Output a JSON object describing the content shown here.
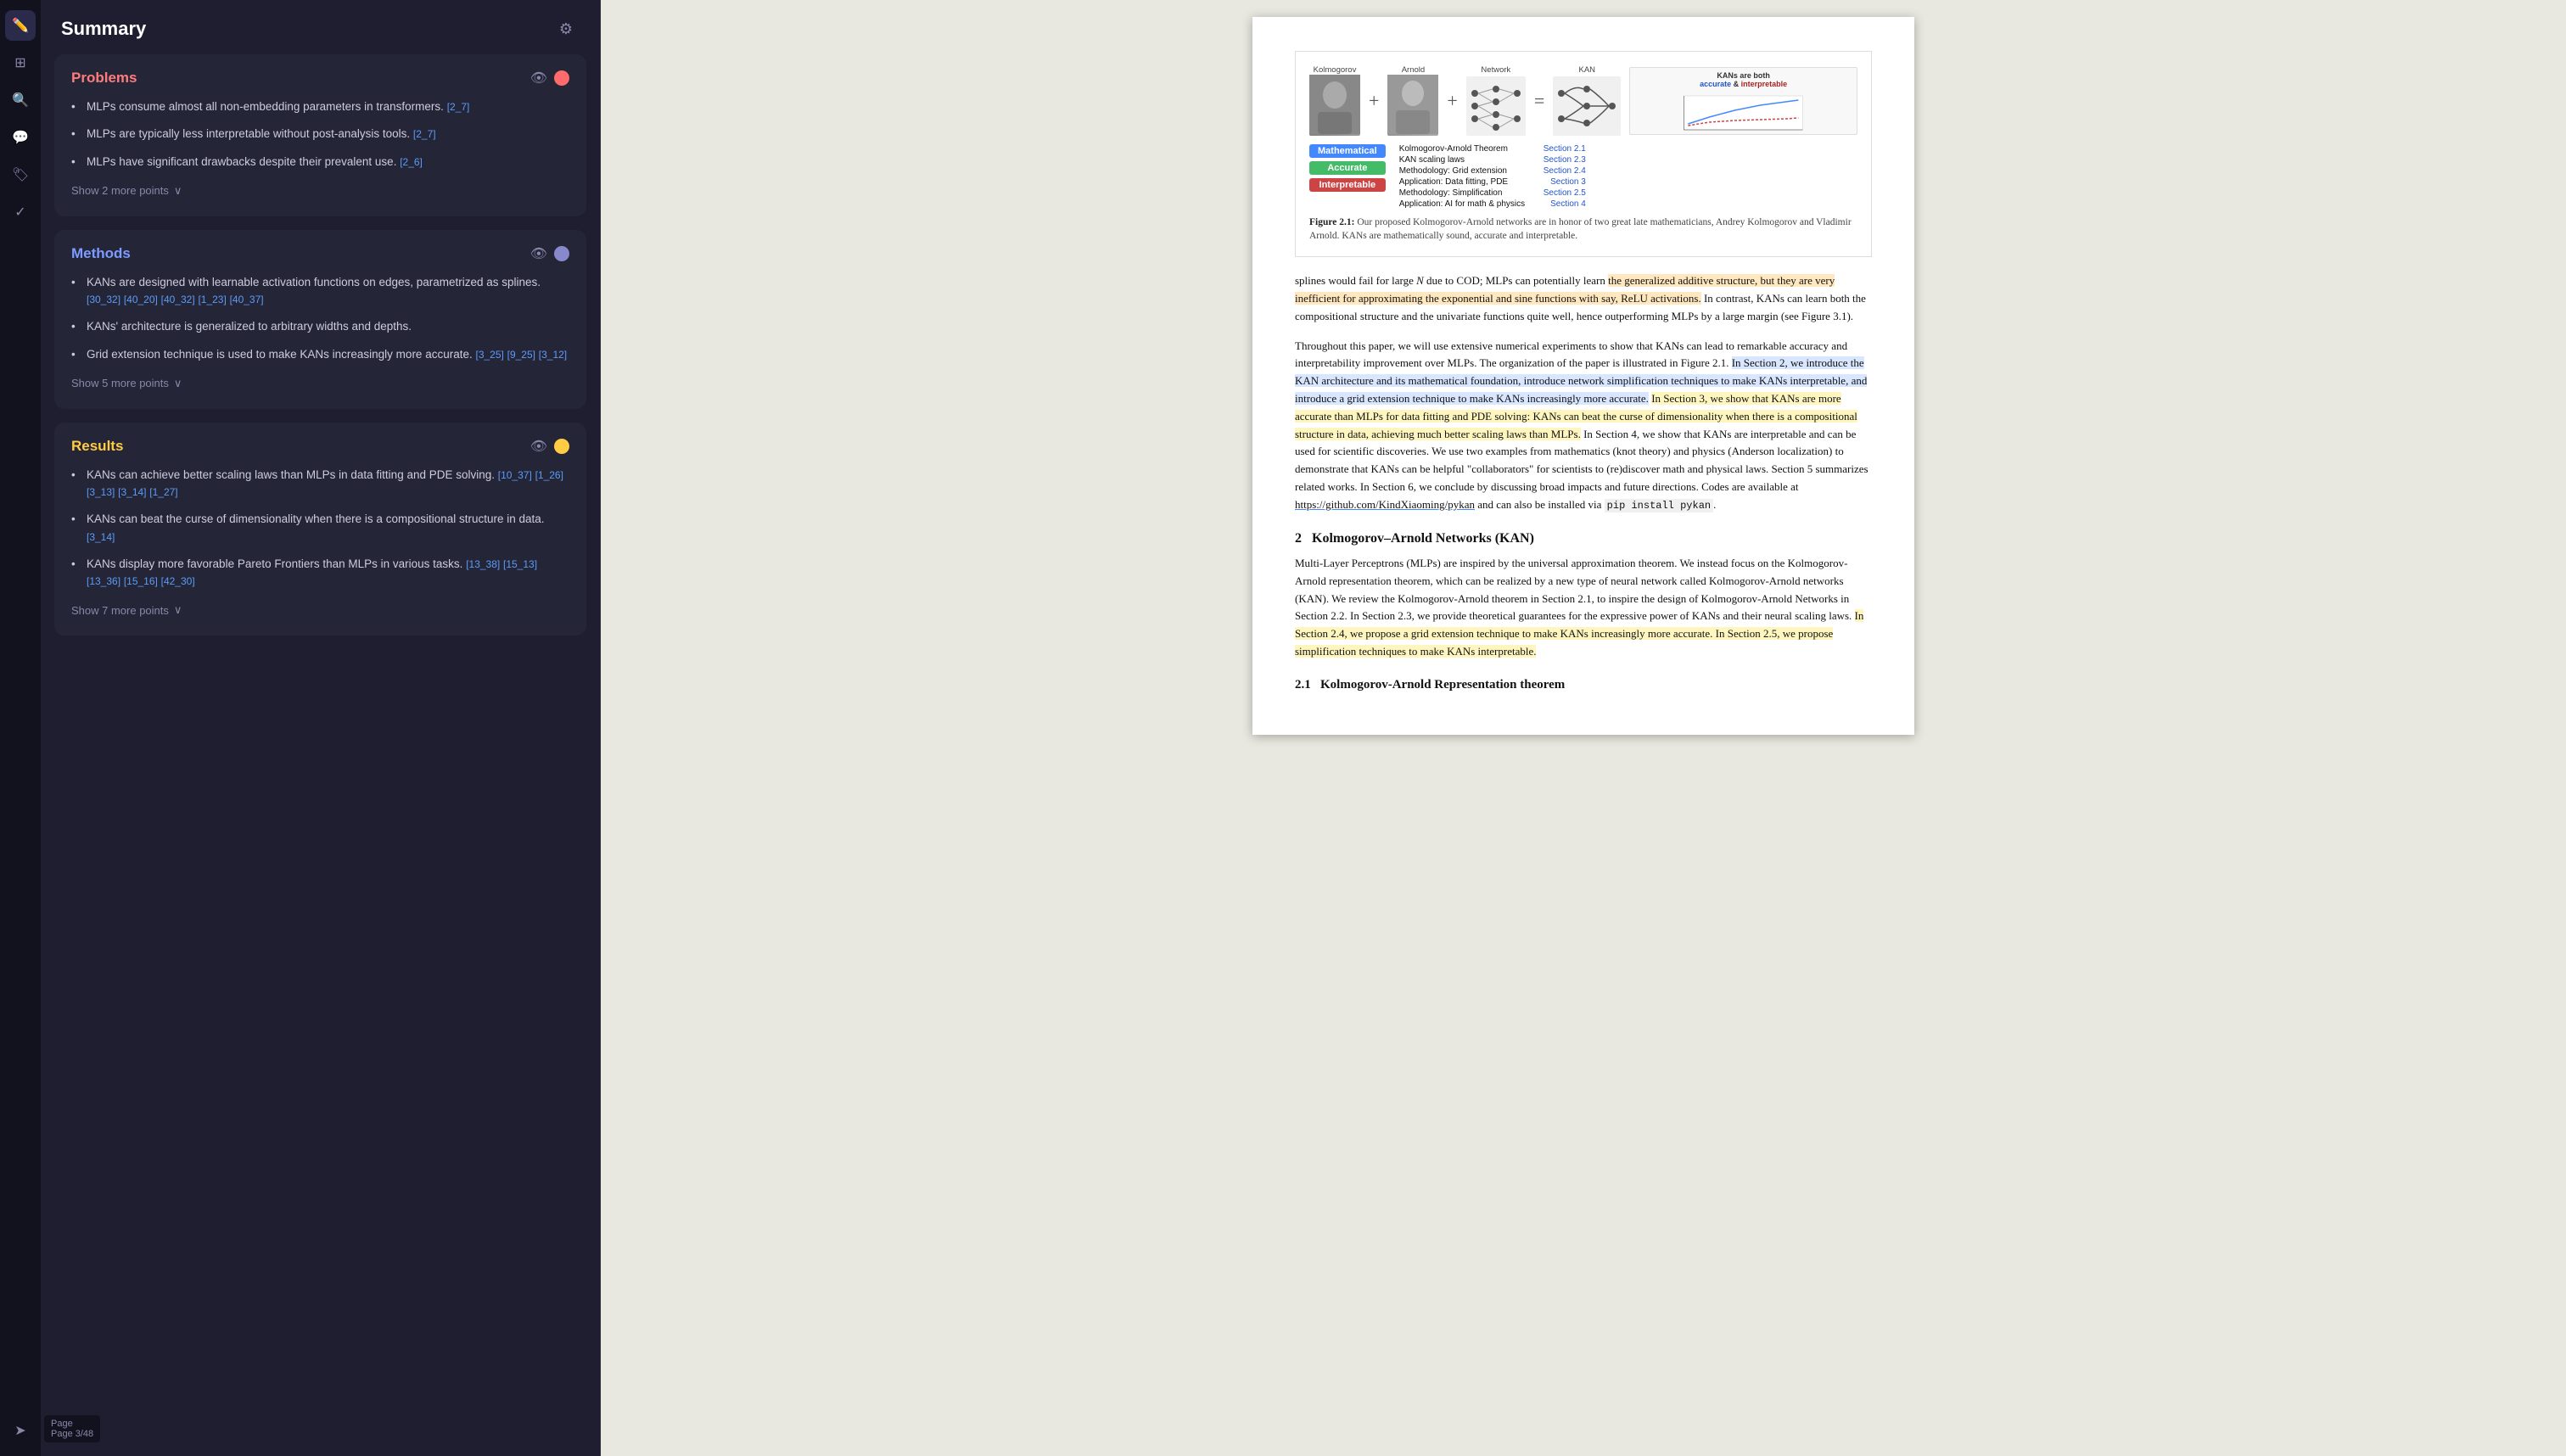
{
  "app": {
    "title": "Summary",
    "page_indicator": "Page\n3/48"
  },
  "sidebar": {
    "icons": [
      {
        "name": "pen-icon",
        "symbol": "✏️",
        "active": true
      },
      {
        "name": "layers-icon",
        "symbol": "⧉",
        "active": false
      },
      {
        "name": "search-icon",
        "symbol": "🔍",
        "active": false
      },
      {
        "name": "chat-icon",
        "symbol": "💬",
        "active": false
      },
      {
        "name": "bookmark-icon",
        "symbol": "🏷️",
        "active": false
      },
      {
        "name": "checkmark-icon",
        "symbol": "✓",
        "active": false
      },
      {
        "name": "send-icon",
        "symbol": "➤",
        "active": false
      }
    ]
  },
  "cards": [
    {
      "id": "problems",
      "title": "Problems",
      "title_class": "problems",
      "dot_color": "#ff6b6b",
      "bullets": [
        "MLPs consume almost all non-embedding parameters in transformers. [2_7]",
        "MLPs are typically less interpretable without post-analysis tools. [2_7]",
        "MLPs have significant drawbacks despite their prevalent use. [2_6]"
      ],
      "refs": [
        "[2_7]",
        "[2_7]",
        "[2_6]"
      ],
      "show_more_label": "Show 2 more points"
    },
    {
      "id": "methods",
      "title": "Methods",
      "title_class": "methods",
      "dot_color": "#8888cc",
      "bullets": [
        "KANs are designed with learnable activation functions on edges, parametrized as splines. [30_32] [40_20] [40_32] [1_23] [40_37]",
        "KANs' architecture is generalized to arbitrary widths and depths.",
        "Grid extension technique is used to make KANs increasingly more accurate. [3_25] [9_25] [3_12]"
      ],
      "refs_first": "[30_32] [40_20] [40_32] [1_23] [40_37]",
      "refs_third": "[3_25] [9_25] [3_12]",
      "show_more_label": "Show 5 more points"
    },
    {
      "id": "results",
      "title": "Results",
      "title_class": "results",
      "dot_color": "#ffcc44",
      "bullets": [
        "KANs can achieve better scaling laws than MLPs in data fitting and PDE solving. [10_37] [1_26] [3_13] [3_14] [1_27]",
        "KANs can beat the curse of dimensionality when there is a compositional structure in data. [3_14]",
        "KANs display more favorable Pareto Frontiers than MLPs in various tasks. [13_38] [15_13] [13_36] [15_16] [42_30]"
      ],
      "show_more_label": "Show 7 more points"
    }
  ],
  "pdf": {
    "figure": {
      "caption": "Figure 2.1: Our proposed Kolmogorov-Arnold networks are in honor of two great late mathematicians, Andrey Kolmogorov and Vladimir Arnold. KANs are mathematically sound, accurate and interpretable.",
      "labels": [
        "Kolmogorov",
        "Arnold",
        "Network",
        "KAN"
      ],
      "chart_label": "KANs are both\naccurate  &  interpretable",
      "legend": {
        "buttons": [
          {
            "label": "Mathematical",
            "class": "mathematical"
          },
          {
            "label": "Accurate",
            "class": "accurate"
          },
          {
            "label": "Interpretable",
            "class": "interpretable"
          }
        ],
        "entries": [
          {
            "text": "Kolmogorov-Arnold Theorem",
            "section": "Section 2.1"
          },
          {
            "text": "KAN scaling laws",
            "section": "Section 2.3"
          },
          {
            "text": "Methodology: Grid extension",
            "section": "Section 2.4"
          },
          {
            "text": "Application: Data fitting, PDE",
            "section": "Section 3"
          },
          {
            "text": "Methodology: Simplification",
            "section": "Section 2.5"
          },
          {
            "text": "Application: AI for math & physics",
            "section": "Section 4"
          }
        ]
      }
    },
    "paragraphs": [
      {
        "id": "para1",
        "text": "splines would fail for large N due to COD; MLPs can potentially learn the generalized additive structure, but they are very inefficient for approximating the exponential and sine functions with say, ReLU activations. In contrast, KANs can learn both the compositional structure and the univariate functions quite well, hence outperforming MLPs by a large margin (see Figure 3.1).",
        "highlights": [
          {
            "text": "the generalized additive structure, but they are very inefficient for approximating the exponential and sine functions with say, ReLU activations.",
            "type": "orange"
          }
        ]
      },
      {
        "id": "para2",
        "text": "Throughout this paper, we will use extensive numerical experiments to show that KANs can lead to remarkable accuracy and interpretability improvement over MLPs. The organization of the paper is illustrated in Figure 2.1. In Section 2, we introduce the KAN architecture and its mathematical foundation, introduce network simplification techniques to make KANs interpretable, and introduce a grid extension technique to make KANs increasingly more accurate. In Section 3, we show that KANs are more accurate than MLPs for data fitting and PDE solving: KANs can beat the curse of dimensionality when there is a compositional structure in data, achieving much better scaling laws than MLPs. In Section 4, we show that KANs are interpretable and can be used for scientific discoveries. We use two examples from mathematics (knot theory) and physics (Anderson localization) to demonstrate that KANs can be helpful \"collaborators\" for scientists to (re)discover math and physical laws. Section 5 summarizes related works. In Section 6, we conclude by discussing broad impacts and future directions. Codes are available at https://github.com/KindXiaoming/pykan and can also be installed via pip install pykan.",
        "highlight_blue": "In Section 2, we introduce the KAN architecture and its mathematical foundation, introduce network simplification techniques to make KANs interpretable, and introduce a grid extension technique to make KANs increasingly more accurate.",
        "highlight_yellow": "In Section 3, we show that KANs are more accurate than MLPs for data fitting and PDE solving: KANs can beat the curse of dimensionality when there is a compositional structure in data, achieving much better scaling laws than MLPs.",
        "underline": "In Section 2.4, we propose a grid extension technique to make KANs increasingly more accurate.",
        "code": "pip install pykan",
        "url": "https://github.com/KindXiaoming/pykan"
      },
      {
        "id": "section2-heading",
        "text": "2   Kolmogorov–Arnold Networks (KAN)"
      },
      {
        "id": "para3",
        "text": "Multi-Layer Perceptrons (MLPs) are inspired by the universal approximation theorem. We instead focus on the Kolmogorov-Arnold representation theorem, which can be realized by a new type of neural network called Kolmogorov-Arnold networks (KAN). We review the Kolmogorov-Arnold theorem in Section 2.1, to inspire the design of Kolmogorov-Arnold Networks in Section 2.2. In Section 2.3, we provide theoretical guarantees for the expressive power of KANs and their neural scaling laws. In Section 2.4, we propose a grid extension technique to make KANs increasingly more accurate. In Section 2.5, we propose simplification techniques to make KANs interpretable.",
        "highlight_yellow2": "In Section 2.4, we propose a grid extension technique to make KANs increasingly more accurate. In Section 2.5, we propose simplification techniques to make KANs interpretable."
      },
      {
        "id": "section21-heading",
        "text": "2.1   Kolmogorov-Arnold Representation theorem"
      }
    ]
  }
}
